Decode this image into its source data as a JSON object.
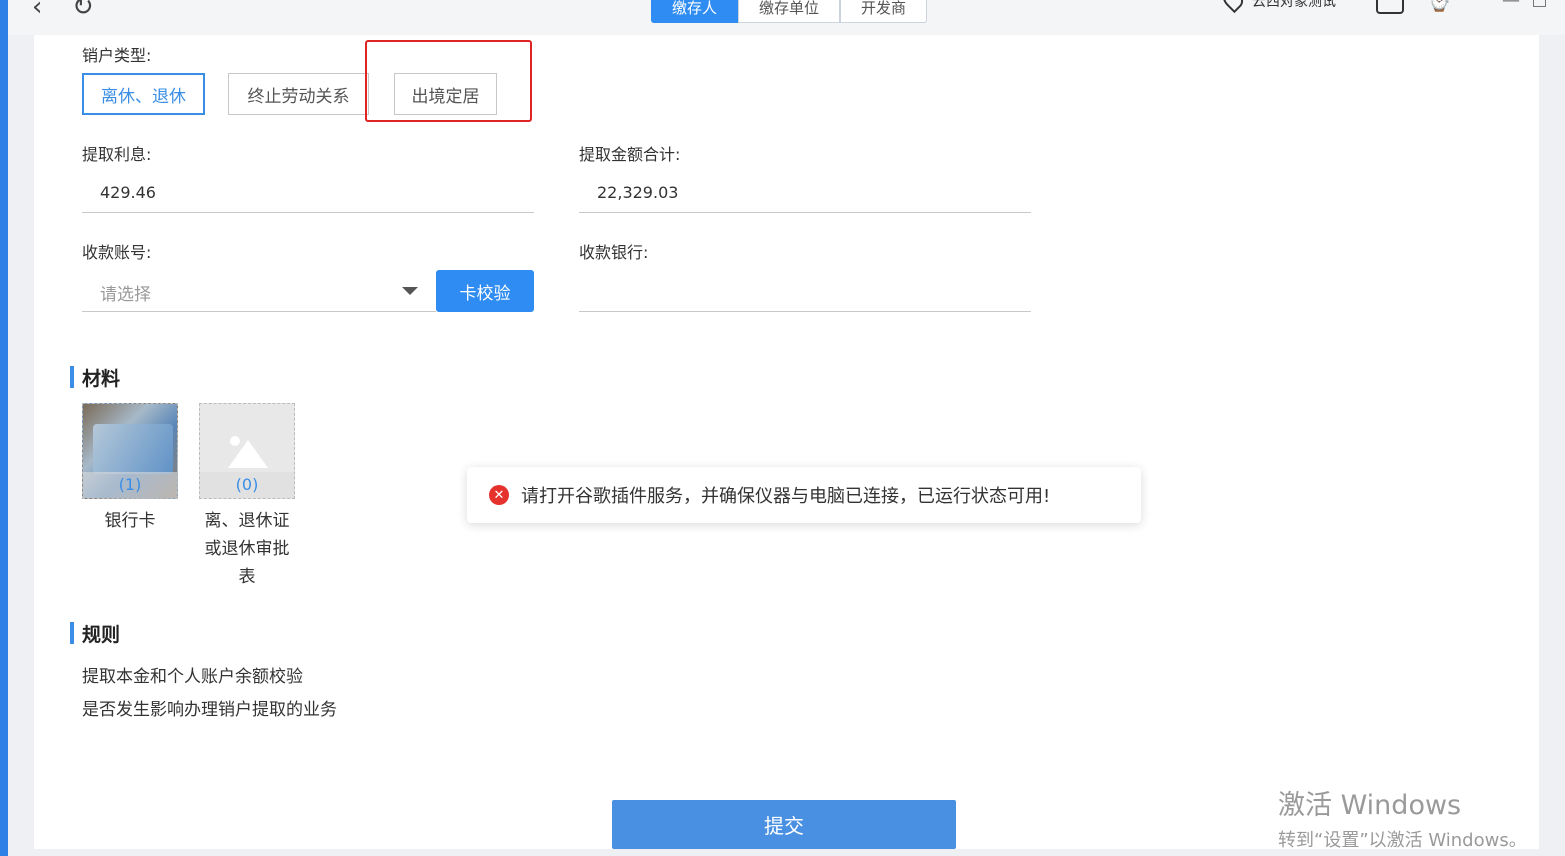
{
  "topbar": {
    "tabs": [
      {
        "label": "缴存人",
        "active": true
      },
      {
        "label": "缴存单位",
        "active": false
      },
      {
        "label": "开发商",
        "active": false
      }
    ],
    "location": "云西对象测试"
  },
  "form": {
    "cancel_type_label": "销户类型:",
    "cancel_types": [
      "离休、退休",
      "终止劳动关系",
      "出境定居"
    ],
    "selected_type": "离休、退休",
    "interest_label": "提取利息:",
    "interest_value": "429.46",
    "total_label": "提取金额合计:",
    "total_value": "22,329.03",
    "account_label": "收款账号:",
    "account_placeholder": "请选择",
    "verify_button": "卡校验",
    "bank_label": "收款银行:"
  },
  "materials": {
    "title": "材料",
    "items": [
      {
        "count": "(1)",
        "caption_lines": [
          "银行卡"
        ]
      },
      {
        "count": "(0)",
        "caption_lines": [
          "离、退休证",
          "或退休审批",
          "表"
        ]
      }
    ]
  },
  "rules": {
    "title": "规则",
    "lines": [
      "提取本金和个人账户余额校验",
      "是否发生影响办理销户提取的业务"
    ]
  },
  "toast": {
    "icon": "error-icon",
    "message": "请打开谷歌插件服务，并确保仪器与电脑已连接，已运行状态可用!"
  },
  "submit_button": "提交",
  "watermark": {
    "title": "激活 Windows",
    "subtitle": "转到“设置”以激活 Windows。"
  },
  "colors": {
    "primary": "#2f8cf2",
    "highlight": "#e02424",
    "error": "#e5322d"
  }
}
